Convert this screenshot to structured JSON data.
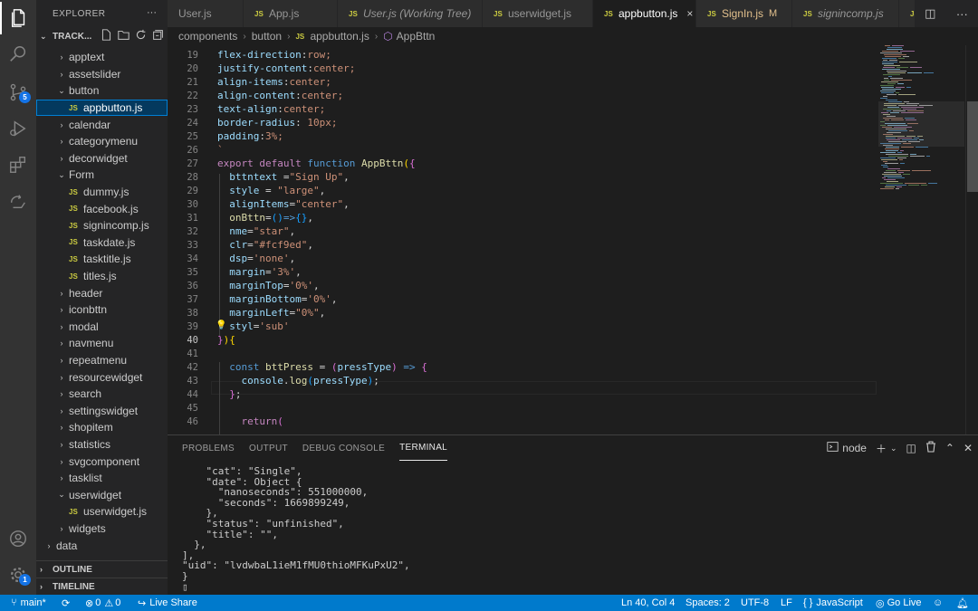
{
  "colors": {
    "accent": "#007acc",
    "activity_bar": "#333333",
    "sidebar": "#252526",
    "editor": "#1e1e1e",
    "js_icon": "#cbcb41",
    "modified": "#e2c08d"
  },
  "activity_bar": {
    "icons": [
      "files-icon",
      "search-icon",
      "source-control-icon",
      "run-debug-icon",
      "extensions-icon",
      "live-share-icon",
      "account-icon",
      "manage-gear-icon"
    ],
    "scm_badge": "5",
    "manage_badge": "1"
  },
  "sidebar": {
    "title": "EXPLORER",
    "more": "···",
    "section": "TRACK...",
    "tree": [
      {
        "label": "apptext",
        "type": "folder",
        "depth": 1,
        "expanded": false
      },
      {
        "label": "assetslider",
        "type": "folder",
        "depth": 1,
        "expanded": false
      },
      {
        "label": "button",
        "type": "folder",
        "depth": 1,
        "expanded": true
      },
      {
        "label": "appbutton.js",
        "type": "file",
        "depth": 2,
        "selected": true
      },
      {
        "label": "calendar",
        "type": "folder",
        "depth": 1,
        "expanded": false
      },
      {
        "label": "categorymenu",
        "type": "folder",
        "depth": 1,
        "expanded": false
      },
      {
        "label": "decorwidget",
        "type": "folder",
        "depth": 1,
        "expanded": false
      },
      {
        "label": "Form",
        "type": "folder",
        "depth": 1,
        "expanded": true
      },
      {
        "label": "dummy.js",
        "type": "file",
        "depth": 2
      },
      {
        "label": "facebook.js",
        "type": "file",
        "depth": 2
      },
      {
        "label": "signincomp.js",
        "type": "file",
        "depth": 2
      },
      {
        "label": "taskdate.js",
        "type": "file",
        "depth": 2
      },
      {
        "label": "tasktitle.js",
        "type": "file",
        "depth": 2
      },
      {
        "label": "titles.js",
        "type": "file",
        "depth": 2
      },
      {
        "label": "header",
        "type": "folder",
        "depth": 1,
        "expanded": false
      },
      {
        "label": "iconbttn",
        "type": "folder",
        "depth": 1,
        "expanded": false
      },
      {
        "label": "modal",
        "type": "folder",
        "depth": 1,
        "expanded": false
      },
      {
        "label": "navmenu",
        "type": "folder",
        "depth": 1,
        "expanded": false
      },
      {
        "label": "repeatmenu",
        "type": "folder",
        "depth": 1,
        "expanded": false
      },
      {
        "label": "resourcewidget",
        "type": "folder",
        "depth": 1,
        "expanded": false
      },
      {
        "label": "search",
        "type": "folder",
        "depth": 1,
        "expanded": false
      },
      {
        "label": "settingswidget",
        "type": "folder",
        "depth": 1,
        "expanded": false
      },
      {
        "label": "shopitem",
        "type": "folder",
        "depth": 1,
        "expanded": false
      },
      {
        "label": "statistics",
        "type": "folder",
        "depth": 1,
        "expanded": false
      },
      {
        "label": "svgcomponent",
        "type": "folder",
        "depth": 1,
        "expanded": false
      },
      {
        "label": "tasklist",
        "type": "folder",
        "depth": 1,
        "expanded": false
      },
      {
        "label": "userwidget",
        "type": "folder",
        "depth": 1,
        "expanded": true
      },
      {
        "label": "userwidget.js",
        "type": "file",
        "depth": 2
      },
      {
        "label": "widgets",
        "type": "folder",
        "depth": 1,
        "expanded": false
      },
      {
        "label": "data",
        "type": "folder",
        "depth": 0,
        "expanded": false
      }
    ],
    "outline": "OUTLINE",
    "timeline": "TIMELINE"
  },
  "tabs": [
    {
      "label": "User.js",
      "icon": "",
      "active": false
    },
    {
      "label": "App.js",
      "icon": "JS",
      "active": false
    },
    {
      "label": "User.js (Working Tree)",
      "icon": "JS",
      "active": false
    },
    {
      "label": "userwidget.js",
      "icon": "JS",
      "active": false
    },
    {
      "label": "appbutton.js",
      "icon": "JS",
      "active": true,
      "close": "×"
    },
    {
      "label": "SignIn.js",
      "icon": "JS",
      "active": false,
      "modified": "M"
    },
    {
      "label": "signincomp.js",
      "icon": "JS",
      "active": false
    },
    {
      "label": "",
      "icon": "JS",
      "active": false
    }
  ],
  "breadcrumb": {
    "parts": [
      "components",
      "button",
      "appbutton.js",
      "AppBttn"
    ],
    "js_icon": "JS"
  },
  "editor": {
    "current_line": 40,
    "lines": [
      {
        "n": "19",
        "t": [
          [
            "c-prop",
            "flex-direction"
          ],
          [
            "c-pun",
            ":"
          ],
          [
            "c-str",
            "row;"
          ]
        ]
      },
      {
        "n": "20",
        "t": [
          [
            "c-prop",
            "justify-content"
          ],
          [
            "c-pun",
            ":"
          ],
          [
            "c-str",
            "center;"
          ]
        ]
      },
      {
        "n": "21",
        "t": [
          [
            "c-prop",
            "align-items"
          ],
          [
            "c-pun",
            ":"
          ],
          [
            "c-str",
            "center;"
          ]
        ]
      },
      {
        "n": "22",
        "t": [
          [
            "c-prop",
            "align-content"
          ],
          [
            "c-pun",
            ":"
          ],
          [
            "c-str",
            "center;"
          ]
        ]
      },
      {
        "n": "23",
        "t": [
          [
            "c-prop",
            "text-align"
          ],
          [
            "c-pun",
            ":"
          ],
          [
            "c-str",
            "center;"
          ]
        ]
      },
      {
        "n": "24",
        "t": [
          [
            "c-prop",
            "border-radius"
          ],
          [
            "c-pun",
            ": "
          ],
          [
            "c-str",
            "10px;"
          ]
        ]
      },
      {
        "n": "25",
        "t": [
          [
            "c-prop",
            "padding"
          ],
          [
            "c-pun",
            ":"
          ],
          [
            "c-str",
            "3%;"
          ]
        ]
      },
      {
        "n": "26",
        "t": [
          [
            "c-str",
            "`"
          ]
        ]
      },
      {
        "n": "27",
        "t": [
          [
            "c-ctl",
            "export "
          ],
          [
            "c-ctl",
            "default "
          ],
          [
            "c-kw",
            "function "
          ],
          [
            "c-fn",
            "AppBttn"
          ],
          [
            "c-br3",
            "("
          ],
          [
            "c-br",
            "{"
          ]
        ]
      },
      {
        "n": "28",
        "t": [
          [
            "c-pun",
            "  "
          ],
          [
            "c-var",
            "bttntext "
          ],
          [
            "c-pun",
            "="
          ],
          [
            "c-str",
            "\"Sign Up\""
          ],
          [
            "c-pun",
            ","
          ]
        ]
      },
      {
        "n": "29",
        "t": [
          [
            "c-pun",
            "  "
          ],
          [
            "c-var",
            "style "
          ],
          [
            "c-pun",
            "= "
          ],
          [
            "c-str",
            "\"large\""
          ],
          [
            "c-pun",
            ","
          ]
        ]
      },
      {
        "n": "30",
        "t": [
          [
            "c-pun",
            "  "
          ],
          [
            "c-var",
            "alignItems"
          ],
          [
            "c-pun",
            "="
          ],
          [
            "c-str",
            "\"center\""
          ],
          [
            "c-pun",
            ","
          ]
        ]
      },
      {
        "n": "31",
        "t": [
          [
            "c-pun",
            "  "
          ],
          [
            "c-fn",
            "onBttn"
          ],
          [
            "c-pun",
            "="
          ],
          [
            "c-br2",
            "()"
          ],
          [
            "c-kw",
            "=>"
          ],
          [
            "c-br2",
            "{}"
          ],
          [
            "c-pun",
            ","
          ]
        ]
      },
      {
        "n": "32",
        "t": [
          [
            "c-pun",
            "  "
          ],
          [
            "c-var",
            "nme"
          ],
          [
            "c-pun",
            "="
          ],
          [
            "c-str",
            "\"star\""
          ],
          [
            "c-pun",
            ","
          ]
        ]
      },
      {
        "n": "33",
        "t": [
          [
            "c-pun",
            "  "
          ],
          [
            "c-var",
            "clr"
          ],
          [
            "c-pun",
            "="
          ],
          [
            "c-str",
            "\"#fcf9ed\""
          ],
          [
            "c-pun",
            ","
          ]
        ]
      },
      {
        "n": "34",
        "t": [
          [
            "c-pun",
            "  "
          ],
          [
            "c-var",
            "dsp"
          ],
          [
            "c-pun",
            "="
          ],
          [
            "c-str",
            "'none'"
          ],
          [
            "c-pun",
            ","
          ]
        ]
      },
      {
        "n": "35",
        "t": [
          [
            "c-pun",
            "  "
          ],
          [
            "c-var",
            "margin"
          ],
          [
            "c-pun",
            "="
          ],
          [
            "c-str",
            "'3%'"
          ],
          [
            "c-pun",
            ","
          ]
        ]
      },
      {
        "n": "36",
        "t": [
          [
            "c-pun",
            "  "
          ],
          [
            "c-var",
            "marginTop"
          ],
          [
            "c-pun",
            "="
          ],
          [
            "c-str",
            "'0%'"
          ],
          [
            "c-pun",
            ","
          ]
        ]
      },
      {
        "n": "37",
        "t": [
          [
            "c-pun",
            "  "
          ],
          [
            "c-var",
            "marginBottom"
          ],
          [
            "c-pun",
            "="
          ],
          [
            "c-str",
            "'0%'"
          ],
          [
            "c-pun",
            ","
          ]
        ]
      },
      {
        "n": "38",
        "t": [
          [
            "c-pun",
            "  "
          ],
          [
            "c-var",
            "marginLeft"
          ],
          [
            "c-pun",
            "="
          ],
          [
            "c-str",
            "\"0%\""
          ],
          [
            "c-pun",
            ","
          ]
        ]
      },
      {
        "n": "39",
        "t": [
          [
            "c-pun",
            "  "
          ],
          [
            "c-var",
            "styl"
          ],
          [
            "c-pun",
            "="
          ],
          [
            "c-str",
            "'sub'"
          ]
        ]
      },
      {
        "n": "40",
        "t": [
          [
            "c-br",
            "}"
          ],
          [
            "c-br3",
            ")"
          ],
          [
            "c-br3",
            "{"
          ]
        ]
      },
      {
        "n": "41",
        "t": []
      },
      {
        "n": "42",
        "t": [
          [
            "c-pun",
            "  "
          ],
          [
            "c-kw",
            "const "
          ],
          [
            "c-fn",
            "bttPress "
          ],
          [
            "c-pun",
            "= "
          ],
          [
            "c-br",
            "("
          ],
          [
            "c-var",
            "pressType"
          ],
          [
            "c-br",
            ")"
          ],
          [
            "c-kw",
            " => "
          ],
          [
            "c-br",
            "{"
          ]
        ]
      },
      {
        "n": "43",
        "t": [
          [
            "c-pun",
            "    "
          ],
          [
            "c-var",
            "console"
          ],
          [
            "c-pun",
            "."
          ],
          [
            "c-fn",
            "log"
          ],
          [
            "c-br2",
            "("
          ],
          [
            "c-var",
            "pressType"
          ],
          [
            "c-br2",
            ")"
          ],
          [
            "c-pun",
            ";"
          ]
        ]
      },
      {
        "n": "44",
        "t": [
          [
            "c-pun",
            "  "
          ],
          [
            "c-br",
            "}"
          ],
          [
            "c-pun",
            ";"
          ]
        ]
      },
      {
        "n": "45",
        "t": []
      },
      {
        "n": "46",
        "t": [
          [
            "c-pun",
            "    "
          ],
          [
            "c-ctl",
            "return"
          ],
          [
            "c-br",
            "("
          ]
        ]
      }
    ],
    "lightbulb": "💡"
  },
  "panel": {
    "tabs": [
      "PROBLEMS",
      "OUTPUT",
      "DEBUG CONSOLE",
      "TERMINAL"
    ],
    "active_tab": "TERMINAL",
    "terminal_name": "node",
    "terminal_lines": [
      "    \"cat\": \"Single\",",
      "    \"date\": Object {",
      "      \"nanoseconds\": 551000000,",
      "      \"seconds\": 1669899249,",
      "    },",
      "    \"status\": \"unfinished\",",
      "    \"title\": \"\",",
      "  },",
      "],",
      "\"uid\": \"lvdwbaL1ieM1fMU0thioMFKuPxU2\",",
      "}",
      "▯"
    ]
  },
  "statusbar": {
    "branch": "main*",
    "sync": "⟳",
    "errors": "0",
    "warnings": "0",
    "live_share": "Live Share",
    "position": "Ln 40, Col 4",
    "spaces": "Spaces: 2",
    "encoding": "UTF-8",
    "eol": "LF",
    "language": "JavaScript",
    "go_live": "Go Live"
  }
}
